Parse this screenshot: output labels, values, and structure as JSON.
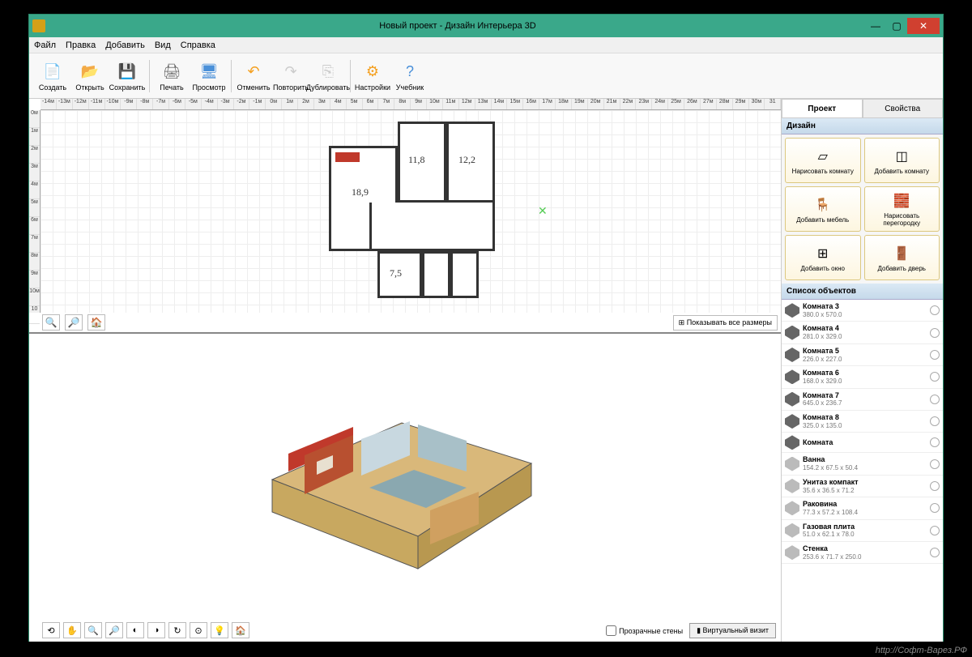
{
  "window": {
    "title": "Новый проект - Дизайн Интерьера 3D"
  },
  "menu": [
    "Файл",
    "Правка",
    "Добавить",
    "Вид",
    "Справка"
  ],
  "toolbar": [
    {
      "label": "Создать",
      "icon": "📄",
      "color": "#fff"
    },
    {
      "label": "Открыть",
      "icon": "📂",
      "color": "#f4c430"
    },
    {
      "label": "Сохранить",
      "icon": "💾",
      "color": "#4a90d9"
    },
    {
      "label": "Печать",
      "icon": "🖨",
      "color": "#666"
    },
    {
      "label": "Просмотр",
      "icon": "🖥",
      "color": "#4a90d9"
    },
    {
      "label": "Отменить",
      "icon": "↶",
      "color": "#f4a020"
    },
    {
      "label": "Повторить",
      "icon": "↷",
      "color": "#ccc"
    },
    {
      "label": "Дублировать",
      "icon": "⎘",
      "color": "#ccc"
    },
    {
      "label": "Настройки",
      "icon": "⚙",
      "color": "#f4a020"
    },
    {
      "label": "Учебник",
      "icon": "?",
      "color": "#4a90d9"
    }
  ],
  "ruler_h": [
    "-14м",
    "-13м",
    "-12м",
    "-11м",
    "-10м",
    "-9м",
    "-8м",
    "-7м",
    "-6м",
    "-5м",
    "-4м",
    "-3м",
    "-2м",
    "-1м",
    "0м",
    "1м",
    "2м",
    "3м",
    "4м",
    "5м",
    "6м",
    "7м",
    "8м",
    "9м",
    "10м",
    "11м",
    "12м",
    "13м",
    "14м",
    "15м",
    "16м",
    "17м",
    "18м",
    "19м",
    "20м",
    "21м",
    "22м",
    "23м",
    "24м",
    "25м",
    "26м",
    "27м",
    "28м",
    "29м",
    "30м",
    "31"
  ],
  "ruler_v": [
    "0м",
    "1м",
    "2м",
    "3м",
    "4м",
    "5м",
    "6м",
    "7м",
    "8м",
    "9м",
    "10м",
    "10"
  ],
  "rooms": {
    "r1": "18,9",
    "r2": "11,8",
    "r3": "12,2",
    "r4": "7,5"
  },
  "show_dims": "Показывать все размеры",
  "render": {
    "transparent_walls": "Прозрачные стены",
    "virtual_tour": "Виртуальный визит"
  },
  "tabs": {
    "project": "Проект",
    "properties": "Свойства"
  },
  "design_header": "Дизайн",
  "design_buttons": [
    {
      "label": "Нарисовать комнату",
      "icon": "▱"
    },
    {
      "label": "Добавить комнату",
      "icon": "◫"
    },
    {
      "label": "Добавить мебель",
      "icon": "🪑"
    },
    {
      "label": "Нарисовать перегородку",
      "icon": "🧱"
    },
    {
      "label": "Добавить окно",
      "icon": "⊞"
    },
    {
      "label": "Добавить дверь",
      "icon": "🚪"
    }
  ],
  "objects_header": "Список объектов",
  "objects": [
    {
      "name": "Комната 3",
      "size": "380.0 x 570.0",
      "type": "room"
    },
    {
      "name": "Комната 4",
      "size": "281.0 x 329.0",
      "type": "room"
    },
    {
      "name": "Комната 5",
      "size": "226.0 x 227.0",
      "type": "room"
    },
    {
      "name": "Комната 6",
      "size": "168.0 x 329.0",
      "type": "room"
    },
    {
      "name": "Комната 7",
      "size": "645.0 x 236.7",
      "type": "room"
    },
    {
      "name": "Комната 8",
      "size": "325.0 x 135.0",
      "type": "room"
    },
    {
      "name": "Комната",
      "size": "",
      "type": "room"
    },
    {
      "name": "Ванна",
      "size": "154.2 x 67.5 x 50.4",
      "type": "item"
    },
    {
      "name": "Унитаз компакт",
      "size": "35.6 x 36.5 x 71.2",
      "type": "item"
    },
    {
      "name": "Раковина",
      "size": "77.3 x 57.2 x 108.4",
      "type": "item"
    },
    {
      "name": "Газовая плита",
      "size": "51.0 x 62.1 x 78.0",
      "type": "item"
    },
    {
      "name": "Стенка",
      "size": "253.6 x 71.7 x 250.0",
      "type": "item"
    }
  ],
  "watermark": "http://Софт-Варез.РФ"
}
